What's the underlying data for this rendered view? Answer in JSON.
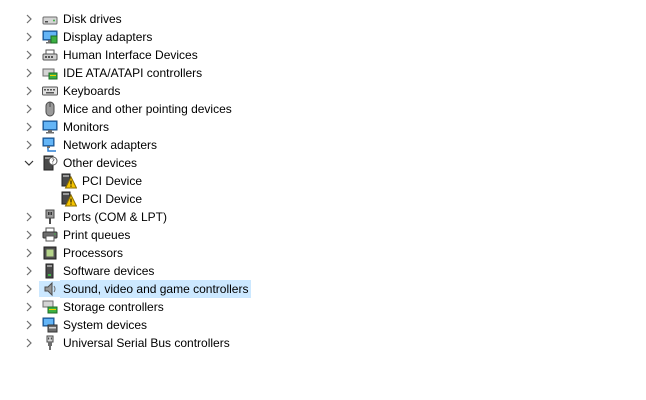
{
  "tree": {
    "disk": "Disk drives",
    "display": "Display adapters",
    "hid": "Human Interface Devices",
    "ide": "IDE ATA/ATAPI controllers",
    "keyboards": "Keyboards",
    "mice": "Mice and other pointing devices",
    "monitors": "Monitors",
    "network": "Network adapters",
    "other": "Other devices",
    "pci1": "PCI Device",
    "pci2": "PCI Device",
    "ports": "Ports (COM & LPT)",
    "print": "Print queues",
    "processors": "Processors",
    "software": "Software devices",
    "sound": "Sound, video and game controllers",
    "storage": "Storage controllers",
    "system": "System devices",
    "usb": "Universal Serial Bus controllers"
  },
  "colors": {
    "selection": "#cce8ff",
    "chevron": "#6f6f6f",
    "warning": "#f5c400"
  }
}
